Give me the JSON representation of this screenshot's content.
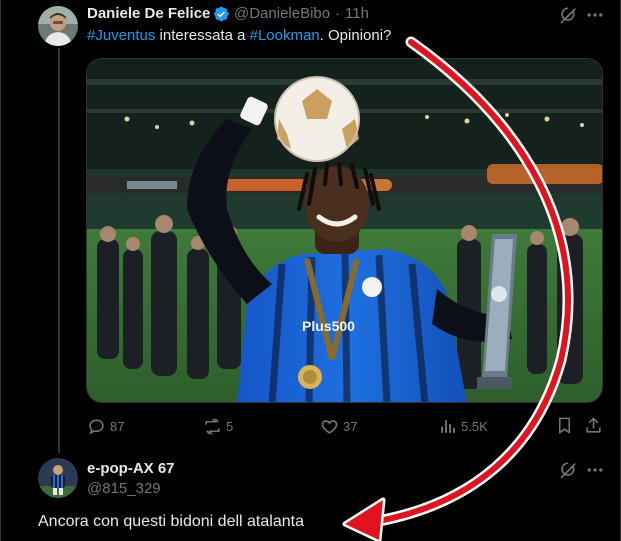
{
  "tweet": {
    "author_name": "Daniele De Felice",
    "handle": "@DanieleBibo",
    "separator": "·",
    "time": "11h",
    "text_parts": [
      "#Juventus",
      " interessata a ",
      "#Lookman",
      ". Opinioni?"
    ],
    "image_alt": "Football player in blue and black kit holding a ball on his head and a trophy",
    "stats": {
      "replies": "87",
      "reposts": "5",
      "likes": "37",
      "views": "5.5K"
    }
  },
  "reply": {
    "author_name": "e-pop-AX 67",
    "handle": "@815_329",
    "text": "Ancora con questi bidoni dell atalanta"
  },
  "colors": {
    "background": "#000000",
    "text": "#e7e9ea",
    "secondary": "#71767b",
    "link": "#1d9bf0",
    "arrow": "#e0141e"
  },
  "icons": [
    "verified-badge-icon",
    "grok-icon",
    "more-icon",
    "reply-icon",
    "repost-icon",
    "like-icon",
    "views-icon",
    "bookmark-icon",
    "share-icon"
  ]
}
